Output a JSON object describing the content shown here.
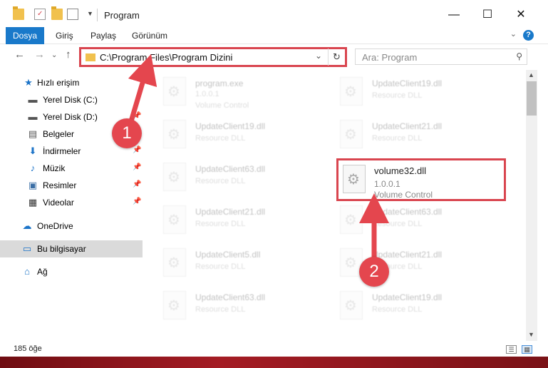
{
  "window": {
    "title": "Program"
  },
  "ribbon": {
    "tabs": [
      "Dosya",
      "Giriş",
      "Paylaş",
      "Görünüm"
    ],
    "help_icon": "question-icon"
  },
  "address": {
    "path": "C:\\Program Files\\Program Dizini"
  },
  "search": {
    "placeholder": "Ara: Program"
  },
  "sidebar": {
    "items": [
      {
        "label": "Hızlı erişim",
        "icon": "star-icon"
      },
      {
        "label": "Yerel Disk (C:)",
        "icon": "drive-icon"
      },
      {
        "label": "Yerel Disk (D:)",
        "icon": "drive-icon"
      },
      {
        "label": "Belgeler",
        "icon": "document-icon"
      },
      {
        "label": "İndirmeler",
        "icon": "download-icon"
      },
      {
        "label": "Müzik",
        "icon": "music-icon"
      },
      {
        "label": "Resimler",
        "icon": "picture-icon"
      },
      {
        "label": "Videolar",
        "icon": "video-icon"
      },
      {
        "label": "OneDrive",
        "icon": "cloud-icon"
      },
      {
        "label": "Bu bilgisayar",
        "icon": "computer-icon"
      },
      {
        "label": "Ağ",
        "icon": "network-icon"
      }
    ]
  },
  "files": [
    {
      "name": "program.exe",
      "type": "1.0.0.1",
      "desc": "Volume Control"
    },
    {
      "name": "UpdateClient19.dll",
      "type": "Resource DLL"
    },
    {
      "name": "UpdateClient19.dll",
      "type": "Resource DLL"
    },
    {
      "name": "UpdateClient21.dll",
      "type": "Resource DLL"
    },
    {
      "name": "UpdateClient63.dll",
      "type": "Resource DLL"
    },
    {
      "name": "volume32.dll",
      "type": "1.0.0.1",
      "desc": "Volume Control"
    },
    {
      "name": "UpdateClient21.dll",
      "type": "Resource DLL"
    },
    {
      "name": "UpdateClient63.dll",
      "type": "Resource DLL"
    },
    {
      "name": "UpdateClient5.dll",
      "type": "Resource DLL"
    },
    {
      "name": "UpdateClient21.dll",
      "type": "Resource DLL"
    },
    {
      "name": "UpdateClient63.dll",
      "type": "Resource DLL"
    },
    {
      "name": "UpdateClient19.dll",
      "type": "Resource DLL"
    }
  ],
  "status": {
    "count": "185 öğe"
  },
  "annotations": {
    "step1": "1",
    "step2": "2",
    "color": "#e4464e"
  }
}
